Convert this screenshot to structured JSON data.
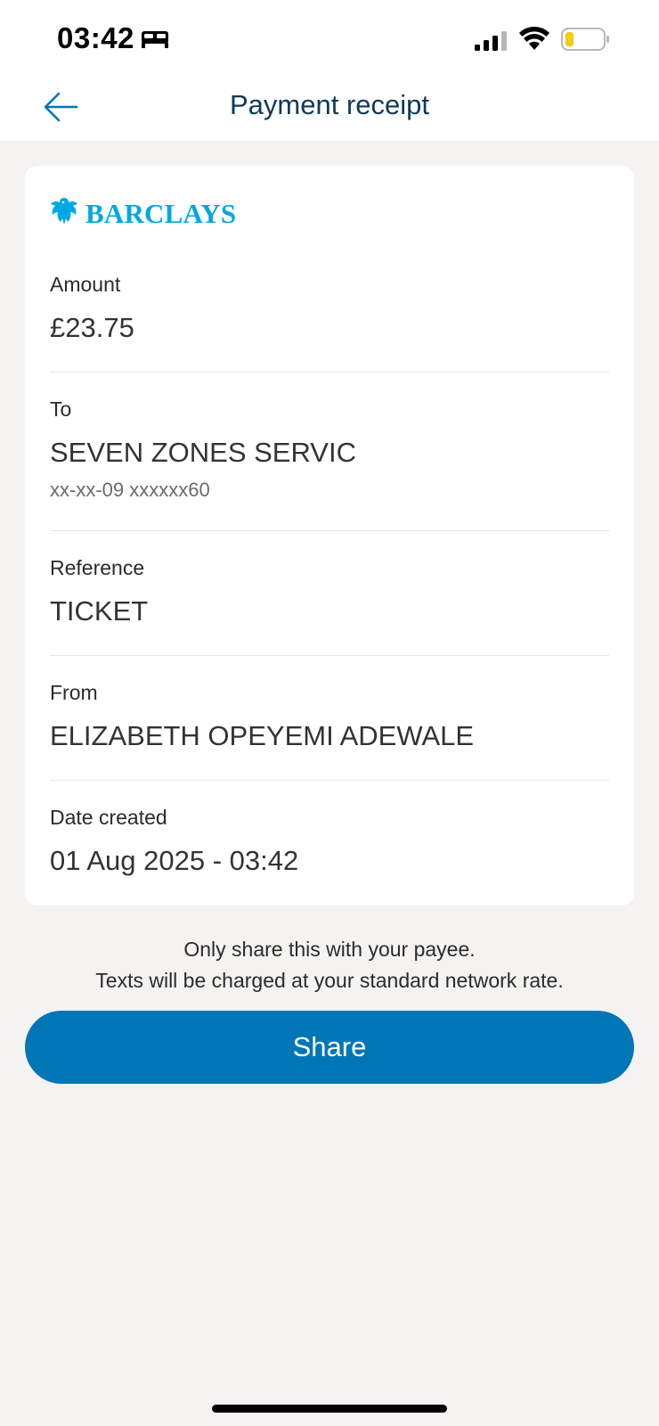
{
  "status_bar": {
    "time": "03:42",
    "icons": [
      "bed-icon",
      "signal-icon",
      "wifi-icon",
      "battery-icon"
    ]
  },
  "header": {
    "title": "Payment receipt",
    "back_icon": "arrow-left-icon"
  },
  "brand": {
    "name": "BARCLAYS",
    "color": "#00a8e1"
  },
  "receipt": {
    "amount": {
      "label": "Amount",
      "value": "£23.75"
    },
    "to": {
      "label": "To",
      "value": "SEVEN ZONES SERVIC",
      "account": "xx-xx-09 xxxxxx60"
    },
    "reference": {
      "label": "Reference",
      "value": "TICKET"
    },
    "from": {
      "label": "From",
      "value": "ELIZABETH OPEYEMI ADEWALE"
    },
    "date_created": {
      "label": "Date created",
      "value": "01 Aug 2025 - 03:42"
    }
  },
  "notice": {
    "line1": "Only share this with your payee.",
    "line2": "Texts will be charged at your standard network rate."
  },
  "actions": {
    "share_label": "Share"
  },
  "colors": {
    "accent": "#0076b6",
    "title": "#0f3a57",
    "background": "#f4f3f2"
  }
}
